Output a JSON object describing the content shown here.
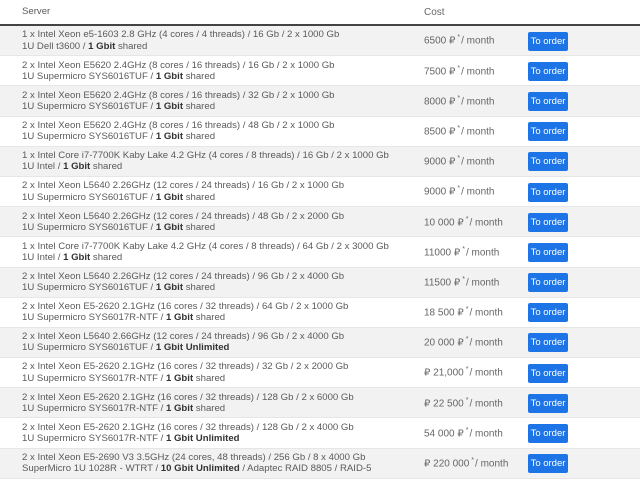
{
  "columns": {
    "server": "Server",
    "cost": "Cost"
  },
  "order_label": "To order",
  "per": "/ month",
  "rows": [
    {
      "l1": "1 x Intel Xeon e5-1603 2.8 GHz (4 cores / 4 threads) / 16 Gb / 2 x 1000 Gb",
      "l2a": "1U Dell t3600 / ",
      "l2b": "1 Gbit",
      "l2c": " shared",
      "price": "6500 ₽"
    },
    {
      "l1": "2 x Intel Xeon E5620 2.4GHz (8 cores / 16 threads) / 16 Gb / 2 x 1000 Gb",
      "l2a": "1U Supermicro SYS6016TUF / ",
      "l2b": "1 Gbit",
      "l2c": " shared",
      "price": "7500 ₽"
    },
    {
      "l1": "2 x Intel Xeon E5620 2.4GHz (8 cores / 16 threads) / 32 Gb / 2 x 1000 Gb",
      "l2a": "1U Supermicro SYS6016TUF / ",
      "l2b": "1 Gbit",
      "l2c": " shared",
      "price": "8000 ₽"
    },
    {
      "l1": "2 x Intel Xeon E5620 2.4GHz (8 cores / 16 threads) / 48 Gb / 2 x 1000 Gb",
      "l2a": "1U Supermicro SYS6016TUF / ",
      "l2b": "1 Gbit",
      "l2c": " shared",
      "price": "8500 ₽"
    },
    {
      "l1": "1 x Intel Core i7-7700K Kaby Lake 4.2 GHz (4 cores / 8 threads) / 16 Gb / 2 x 1000 Gb",
      "l2a": "1U Intel / ",
      "l2b": "1 Gbit",
      "l2c": " shared",
      "price": "9000 ₽"
    },
    {
      "l1": "2 x Intel Xeon L5640 2.26GHz (12 cores / 24 threads) / 16 Gb / 2 x 1000 Gb",
      "l2a": "1U Supermicro SYS6016TUF / ",
      "l2b": "1 Gbit",
      "l2c": " shared",
      "price": "9000 ₽"
    },
    {
      "l1": "2 x Intel Xeon L5640 2.26GHz (12 cores / 24 threads) / 48 Gb / 2 x 2000 Gb",
      "l2a": "1U Supermicro SYS6016TUF / ",
      "l2b": "1 Gbit",
      "l2c": " shared",
      "price": "10 000 ₽"
    },
    {
      "l1": "1 x Intel Core i7-7700K Kaby Lake 4.2 GHz (4 cores / 8 threads) / 64 Gb / 2 x 3000 Gb",
      "l2a": "1U Intel / ",
      "l2b": "1 Gbit",
      "l2c": " shared",
      "price": "11000 ₽"
    },
    {
      "l1": "2 x Intel Xeon L5640 2.26GHz (12 cores / 24 threads) / 96 Gb / 2 x 4000 Gb",
      "l2a": "1U Supermicro SYS6016TUF / ",
      "l2b": "1 Gbit",
      "l2c": " shared",
      "price": "11500 ₽"
    },
    {
      "l1": "2 x Intel Xeon E5-2620 2.1GHz (16 cores / 32 threads) / 64 Gb / 2 x 1000 Gb",
      "l2a": "1U Supermicro SYS6017R-NTF / ",
      "l2b": "1 Gbit",
      "l2c": " shared",
      "price": "18 500 ₽"
    },
    {
      "l1": "2 x Intel Xeon L5640 2.66GHz (12 cores / 24 threads) / 96 Gb / 2 x 4000 Gb",
      "l2a": "1U Supermicro SYS6016TUF / ",
      "l2b": "1 Gbit Unlimited",
      "l2c": "",
      "price": "20 000 ₽"
    },
    {
      "l1": "2 x Intel Xeon E5-2620 2.1GHz (16 cores / 32 threads) / 32 Gb / 2 x 2000 Gb",
      "l2a": "1U Supermicro SYS6017R-NTF / ",
      "l2b": "1 Gbit",
      "l2c": " shared",
      "price": "₽ 21,000"
    },
    {
      "l1": "2 x Intel Xeon E5-2620 2.1GHz (16 cores / 32 threads) / 128 Gb / 2 x 6000 Gb",
      "l2a": "1U Supermicro SYS6017R-NTF / ",
      "l2b": "1 Gbit",
      "l2c": " shared",
      "price": "₽ 22 500"
    },
    {
      "l1": "2 x Intel Xeon E5-2620 2.1GHz (16 cores / 32 threads) / 128 Gb / 2 x 4000 Gb",
      "l2a": "1U Supermicro SYS6017R-NTF / ",
      "l2b": "1 Gbit Unlimited",
      "l2c": "",
      "price": "54 000 ₽"
    },
    {
      "l1": "2 x Intel Xeon E5-2690 V3 3.5GHz (24 cores, 48 threads) / 256 Gb / 8 x 4000 Gb",
      "l2a": "SuperMicro 1U 1028R - WTRT / ",
      "l2b": "10 Gbit Unlimited",
      "l2c": " / Adaptec RAID 8805 / RAID-5",
      "price": "₽ 220 000"
    }
  ]
}
